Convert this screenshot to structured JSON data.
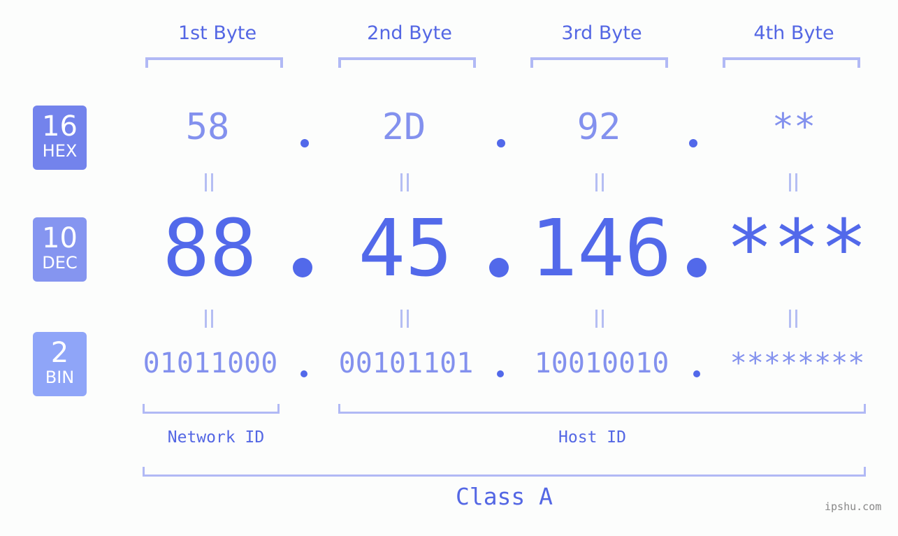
{
  "bytes": [
    {
      "title": "1st Byte",
      "hex": "58",
      "dec": "88",
      "bin": "01011000"
    },
    {
      "title": "2nd Byte",
      "hex": "2D",
      "dec": "45",
      "bin": "00101101"
    },
    {
      "title": "3rd Byte",
      "hex": "92",
      "dec": "146",
      "bin": "10010010"
    },
    {
      "title": "4th Byte",
      "hex": "**",
      "dec": "***",
      "bin": "********"
    }
  ],
  "badges": {
    "hex": {
      "number": "16",
      "label": "HEX",
      "color": "#7383ec"
    },
    "dec": {
      "number": "10",
      "label": "DEC",
      "color": "#8595f0"
    },
    "bin": {
      "number": "2",
      "label": "BIN",
      "color": "#8fa5f8"
    }
  },
  "segments": {
    "network": "Network ID",
    "host": "Host ID"
  },
  "ip_class": "Class A",
  "watermark": "ipshu.com",
  "colors": {
    "accent": "#5269ea",
    "light_accent": "#8391ee",
    "bracket": "#b1b9f5"
  }
}
